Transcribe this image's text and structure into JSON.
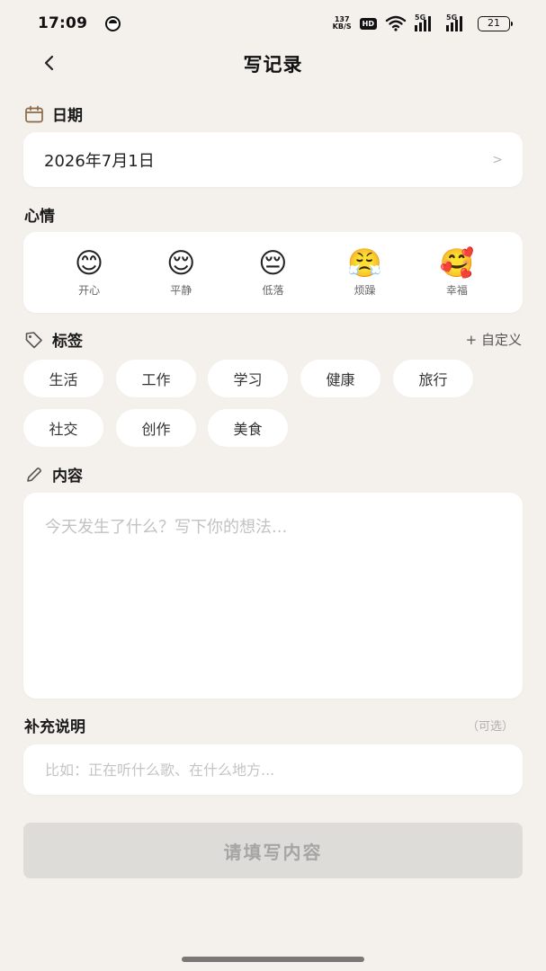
{
  "status_bar": {
    "time": "17:09",
    "net_speed_value": "137",
    "net_speed_unit": "KB/S",
    "hd_label": "HD",
    "signal1_label": "5G",
    "signal2_label": "5G",
    "battery": "21"
  },
  "header": {
    "title": "写记录"
  },
  "date_section": {
    "label": "日期",
    "value": "2026年7月1日",
    "chevron": ">"
  },
  "mood_section": {
    "label": "心情",
    "moods": [
      {
        "emoji": "😊",
        "label": "开心"
      },
      {
        "emoji": "😌",
        "label": "平静"
      },
      {
        "emoji": "😔",
        "label": "低落"
      },
      {
        "emoji": "😤",
        "label": "烦躁"
      },
      {
        "emoji": "🥰",
        "label": "幸福"
      }
    ]
  },
  "tags_section": {
    "label": "标签",
    "custom_label": "+ 自定义",
    "tags": [
      "生活",
      "工作",
      "学习",
      "健康",
      "旅行",
      "社交",
      "创作",
      "美食"
    ]
  },
  "content_section": {
    "label": "内容",
    "placeholder": "今天发生了什么？写下你的想法...",
    "value": ""
  },
  "note_section": {
    "label": "补充说明",
    "optional_hint": "（可选）",
    "placeholder": "比如：正在听什么歌、在什么地方...",
    "value": ""
  },
  "submit": {
    "label": "请填写内容"
  },
  "colors": {
    "background": "#f4f1ec",
    "card": "#ffffff",
    "submit_disabled_bg": "#dedcd9",
    "submit_disabled_text": "#a7a5a3"
  }
}
